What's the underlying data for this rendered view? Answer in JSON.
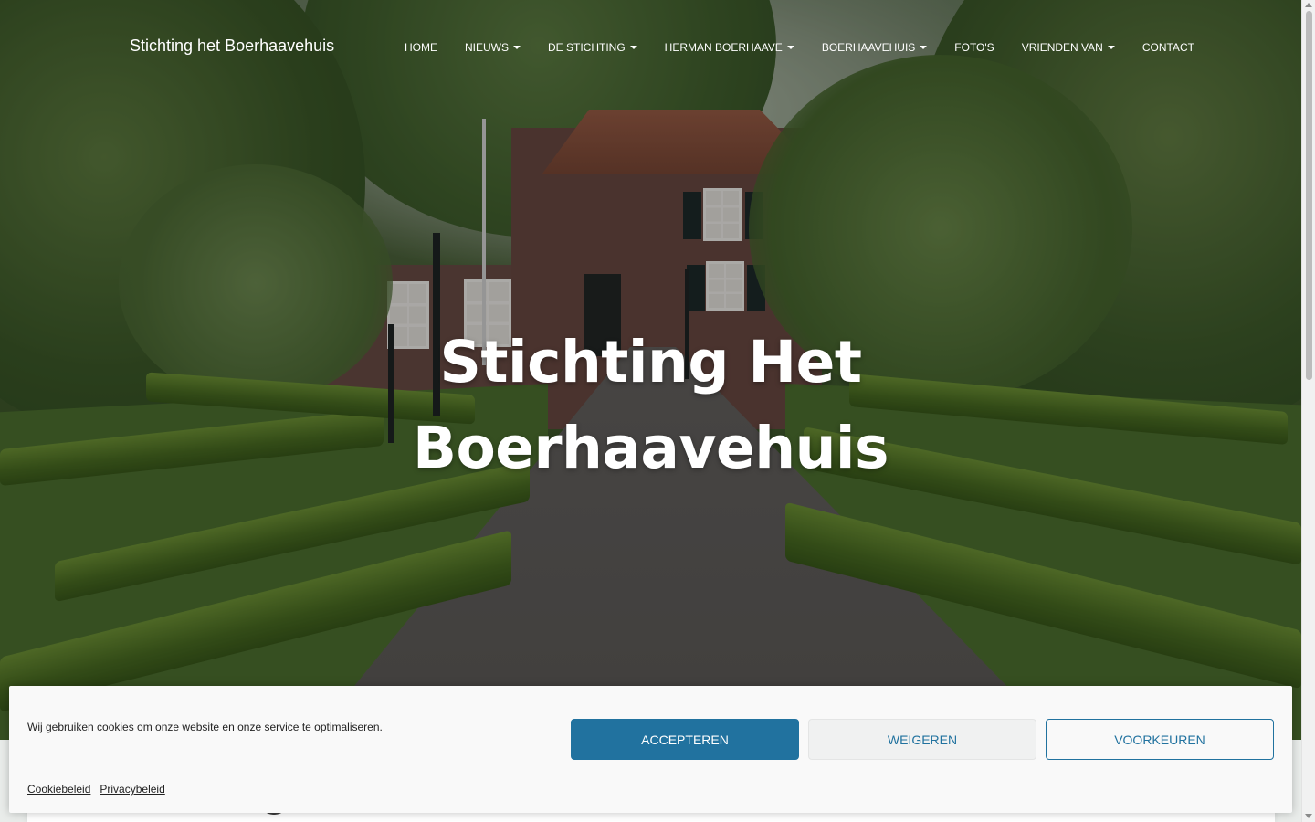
{
  "site": {
    "brand": "Stichting het Boerhaavehuis"
  },
  "nav": {
    "items": [
      {
        "label": "HOME",
        "dropdown": false
      },
      {
        "label": "NIEUWS",
        "dropdown": true
      },
      {
        "label": "DE STICHTING",
        "dropdown": true
      },
      {
        "label": "HERMAN BOERHAAVE",
        "dropdown": true
      },
      {
        "label": "BOERHAAVEHUIS",
        "dropdown": true
      },
      {
        "label": "FOTO'S",
        "dropdown": false
      },
      {
        "label": "VRIENDEN VAN",
        "dropdown": true
      },
      {
        "label": "CONTACT",
        "dropdown": false
      }
    ]
  },
  "hero": {
    "title_line1": "Stichting Het",
    "title_line2": "Boerhaavehuis"
  },
  "cookie": {
    "message": "Wij gebruiken cookies om onze website en onze service te optimaliseren.",
    "accept_label": "ACCEPTEREN",
    "deny_label": "WEIGEREN",
    "prefs_label": "VOORKEUREN",
    "links": [
      "Cookiebeleid",
      "Privacybeleid"
    ]
  },
  "colors": {
    "accent": "#21729f",
    "banner_bg": "#f9f9f9",
    "hero_text": "#ffffff"
  }
}
